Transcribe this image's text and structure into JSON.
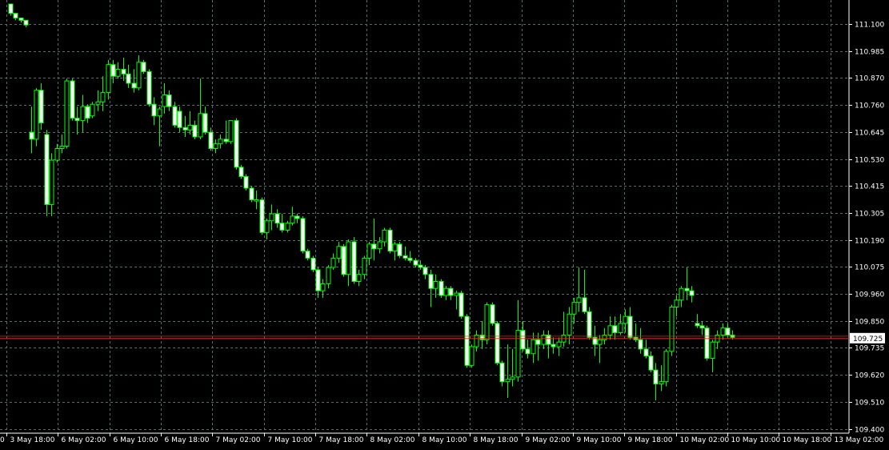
{
  "chart_data": {
    "type": "candlestick",
    "grid": true,
    "colors": {
      "background": "#000000",
      "grid": "#5a6b6b",
      "axis": "#ffffff",
      "text": "#ffffff",
      "bull_body": "#000000",
      "bear_body": "#ffffff",
      "wick": "#00ff00",
      "bid_line": "#ff2020",
      "price_tag_bg": "#ffffff",
      "price_tag_text": "#000000"
    },
    "ylim": [
      109.35,
      111.16
    ],
    "y_ticks": [
      "111.100",
      "110.985",
      "110.870",
      "110.760",
      "110.645",
      "110.530",
      "110.415",
      "110.305",
      "110.190",
      "110.075",
      "109.960",
      "109.850",
      "109.735",
      "109.620",
      "109.510",
      "109.400"
    ],
    "x_ticks": [
      "3 May 18:00",
      "6 May 02:00",
      "6 May 10:00",
      "6 May 18:00",
      "7 May 02:00",
      "7 May 10:00",
      "7 May 18:00",
      "8 May 02:00",
      "8 May 10:00",
      "8 May 18:00",
      "9 May 02:00",
      "9 May 10:00",
      "9 May 18:00",
      "10 May 02:00",
      "10 May 10:00",
      "10 May 18:00",
      "13 May 02:00"
    ],
    "x_tick_left_fragment": "0",
    "current_price": "109.725",
    "candles": [
      [
        111.16,
        111.16,
        111.11,
        111.12
      ],
      [
        111.12,
        111.12,
        111.09,
        111.1
      ],
      [
        111.1,
        111.1,
        111.08,
        111.09
      ],
      [
        111.09,
        111.09,
        111.06,
        111.07
      ],
      [
        110.61,
        110.72,
        110.52,
        110.58
      ],
      [
        110.58,
        110.8,
        110.55,
        110.79
      ],
      [
        110.79,
        110.82,
        110.62,
        110.65
      ],
      [
        110.6,
        110.62,
        110.25,
        110.3
      ],
      [
        110.3,
        110.52,
        110.25,
        110.49
      ],
      [
        110.49,
        110.56,
        110.48,
        110.54
      ],
      [
        110.54,
        110.6,
        110.52,
        110.55
      ],
      [
        110.55,
        110.84,
        110.54,
        110.83
      ],
      [
        110.83,
        110.84,
        110.66,
        110.67
      ],
      [
        110.67,
        110.72,
        110.6,
        110.66
      ],
      [
        110.66,
        110.77,
        110.61,
        110.72
      ],
      [
        110.72,
        110.73,
        110.65,
        110.67
      ],
      [
        110.68,
        110.74,
        110.67,
        110.73
      ],
      [
        110.73,
        110.79,
        110.7,
        110.74
      ],
      [
        110.74,
        110.85,
        110.7,
        110.78
      ],
      [
        110.78,
        110.92,
        110.75,
        110.9
      ],
      [
        110.9,
        110.92,
        110.82,
        110.85
      ],
      [
        110.85,
        110.91,
        110.84,
        110.88
      ],
      [
        110.88,
        110.93,
        110.83,
        110.86
      ],
      [
        110.86,
        110.9,
        110.8,
        110.82
      ],
      [
        110.82,
        110.88,
        110.78,
        110.8
      ],
      [
        110.8,
        110.94,
        110.79,
        110.91
      ],
      [
        110.91,
        110.92,
        110.86,
        110.87
      ],
      [
        110.87,
        110.88,
        110.72,
        110.73
      ],
      [
        110.73,
        110.76,
        110.64,
        110.68
      ],
      [
        110.68,
        110.72,
        110.55,
        110.71
      ],
      [
        110.72,
        110.82,
        110.69,
        110.77
      ],
      [
        110.77,
        110.79,
        110.7,
        110.72
      ],
      [
        110.72,
        110.74,
        110.63,
        110.64
      ],
      [
        110.7,
        110.72,
        110.61,
        110.63
      ],
      [
        110.63,
        110.68,
        110.59,
        110.62
      ],
      [
        110.62,
        110.7,
        110.6,
        110.64
      ],
      [
        110.64,
        110.66,
        110.58,
        110.59
      ],
      [
        110.59,
        110.84,
        110.58,
        110.69
      ],
      [
        110.69,
        110.72,
        110.6,
        110.61
      ],
      [
        110.61,
        110.63,
        110.53,
        110.54
      ],
      [
        110.54,
        110.58,
        110.52,
        110.56
      ],
      [
        110.56,
        110.6,
        110.54,
        110.58
      ],
      [
        110.58,
        110.66,
        110.56,
        110.57
      ],
      [
        110.57,
        110.66,
        110.56,
        110.66
      ],
      [
        110.66,
        110.67,
        110.45,
        110.46
      ],
      [
        110.46,
        110.47,
        110.41,
        110.42
      ],
      [
        110.42,
        110.43,
        110.36,
        110.37
      ],
      [
        110.37,
        110.38,
        110.31,
        110.32
      ],
      [
        110.32,
        110.36,
        110.28,
        110.32
      ],
      [
        110.32,
        110.33,
        110.17,
        110.18
      ],
      [
        110.18,
        110.24,
        110.15,
        110.23
      ],
      [
        110.23,
        110.3,
        110.19,
        110.26
      ],
      [
        110.26,
        110.28,
        110.2,
        110.22
      ],
      [
        110.22,
        110.26,
        110.18,
        110.19
      ],
      [
        110.19,
        110.23,
        110.18,
        110.22
      ],
      [
        110.22,
        110.29,
        110.21,
        110.25
      ],
      [
        110.25,
        110.26,
        110.22,
        110.24
      ],
      [
        110.24,
        110.25,
        110.09,
        110.1
      ],
      [
        110.1,
        110.11,
        110.06,
        110.07
      ],
      [
        110.07,
        110.08,
        110.01,
        110.02
      ],
      [
        110.02,
        110.03,
        109.9,
        109.93
      ],
      [
        109.93,
        109.98,
        109.9,
        109.96
      ],
      [
        109.96,
        110.04,
        109.94,
        110.03
      ],
      [
        110.03,
        110.09,
        110.02,
        110.07
      ],
      [
        110.07,
        110.14,
        110.05,
        110.12
      ],
      [
        110.12,
        110.13,
        109.99,
        110.0
      ],
      [
        110.0,
        110.15,
        109.95,
        110.14
      ],
      [
        110.14,
        110.16,
        109.96,
        109.97
      ],
      [
        109.97,
        110.02,
        109.95,
        110.0
      ],
      [
        110.0,
        110.08,
        109.98,
        110.07
      ],
      [
        110.07,
        110.14,
        110.04,
        110.13
      ],
      [
        110.13,
        110.24,
        110.06,
        110.11
      ],
      [
        110.11,
        110.16,
        110.09,
        110.14
      ],
      [
        110.14,
        110.2,
        110.12,
        110.19
      ],
      [
        110.19,
        110.2,
        110.09,
        110.1
      ],
      [
        110.1,
        110.14,
        110.06,
        110.13
      ],
      [
        110.13,
        110.14,
        110.07,
        110.08
      ],
      [
        110.08,
        110.12,
        110.06,
        110.07
      ],
      [
        110.07,
        110.1,
        110.05,
        110.06
      ],
      [
        110.06,
        110.07,
        110.03,
        110.04
      ],
      [
        110.04,
        110.06,
        110.02,
        110.03
      ],
      [
        110.03,
        110.04,
        109.98,
        110.0
      ],
      [
        110.0,
        110.02,
        109.86,
        109.94
      ],
      [
        109.94,
        110.0,
        109.9,
        109.97
      ],
      [
        109.97,
        109.98,
        109.9,
        109.91
      ],
      [
        109.91,
        109.95,
        109.89,
        109.94
      ],
      [
        109.94,
        109.95,
        109.89,
        109.91
      ],
      [
        109.91,
        109.93,
        109.85,
        109.92
      ],
      [
        109.92,
        109.93,
        109.81,
        109.82
      ],
      [
        109.82,
        109.83,
        109.6,
        109.61
      ],
      [
        109.61,
        109.7,
        109.6,
        109.69
      ],
      [
        109.69,
        109.76,
        109.67,
        109.74
      ],
      [
        109.74,
        109.8,
        109.68,
        109.72
      ],
      [
        109.72,
        109.88,
        109.7,
        109.87
      ],
      [
        109.87,
        109.88,
        109.78,
        109.79
      ],
      [
        109.79,
        109.8,
        109.61,
        109.62
      ],
      [
        109.62,
        109.63,
        109.52,
        109.54
      ],
      [
        109.54,
        109.7,
        109.47,
        109.55
      ],
      [
        109.55,
        109.68,
        109.52,
        109.56
      ],
      [
        109.56,
        109.89,
        109.54,
        109.76
      ],
      [
        109.76,
        109.8,
        109.67,
        109.68
      ],
      [
        109.68,
        109.72,
        109.64,
        109.66
      ],
      [
        109.66,
        109.75,
        109.62,
        109.72
      ],
      [
        109.72,
        109.75,
        109.63,
        109.7
      ],
      [
        109.7,
        109.76,
        109.68,
        109.74
      ],
      [
        109.74,
        109.76,
        109.64,
        109.7
      ],
      [
        109.7,
        109.73,
        109.66,
        109.69
      ],
      [
        109.69,
        109.73,
        109.65,
        109.71
      ],
      [
        109.71,
        109.84,
        109.69,
        109.74
      ],
      [
        109.74,
        109.86,
        109.7,
        109.83
      ],
      [
        109.83,
        109.9,
        109.79,
        109.88
      ],
      [
        109.88,
        110.03,
        109.84,
        109.9
      ],
      [
        109.9,
        110.02,
        109.83,
        109.84
      ],
      [
        109.84,
        109.86,
        109.72,
        109.73
      ],
      [
        109.73,
        109.78,
        109.65,
        109.7
      ],
      [
        109.7,
        109.74,
        109.62,
        109.72
      ],
      [
        109.72,
        109.77,
        109.7,
        109.74
      ],
      [
        109.74,
        109.82,
        109.72,
        109.78
      ],
      [
        109.78,
        109.82,
        109.72,
        109.75
      ],
      [
        109.75,
        109.83,
        109.74,
        109.79
      ],
      [
        109.79,
        109.85,
        109.75,
        109.82
      ],
      [
        109.82,
        109.86,
        109.72,
        109.73
      ],
      [
        109.73,
        109.79,
        109.71,
        109.72
      ],
      [
        109.72,
        109.77,
        109.66,
        109.68
      ],
      [
        109.68,
        109.72,
        109.64,
        109.65
      ],
      [
        109.65,
        109.67,
        109.58,
        109.59
      ],
      [
        109.59,
        109.62,
        109.46,
        109.53
      ],
      [
        109.53,
        109.61,
        109.5,
        109.54
      ],
      [
        109.54,
        109.68,
        109.52,
        109.67
      ],
      [
        109.67,
        109.87,
        109.65,
        109.86
      ],
      [
        109.86,
        109.91,
        109.82,
        109.89
      ],
      [
        109.89,
        109.95,
        109.86,
        109.94
      ],
      [
        109.94,
        110.03,
        109.89,
        109.93
      ],
      [
        109.93,
        109.95,
        109.88,
        109.91
      ],
      [
        109.79,
        109.83,
        109.77,
        109.78
      ],
      [
        109.78,
        109.8,
        109.74,
        109.77
      ],
      [
        109.77,
        109.78,
        109.63,
        109.64
      ],
      [
        109.64,
        109.72,
        109.58,
        109.71
      ],
      [
        109.71,
        109.76,
        109.68,
        109.74
      ],
      [
        109.74,
        109.79,
        109.72,
        109.77
      ],
      [
        109.77,
        109.79,
        109.73,
        109.74
      ],
      [
        109.74,
        109.76,
        109.72,
        109.73
      ]
    ]
  }
}
